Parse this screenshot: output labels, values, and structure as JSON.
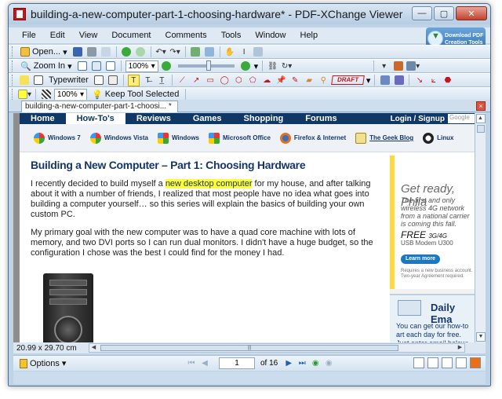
{
  "window": {
    "title": "building-a-new-computer-part-1-choosing-hardware* - PDF-XChange Viewer",
    "controls": {
      "minimize": "—",
      "maximize": "▢",
      "close": "✕"
    }
  },
  "menu": {
    "items": [
      "File",
      "Edit",
      "View",
      "Document",
      "Comments",
      "Tools",
      "Window",
      "Help"
    ],
    "download_badge": "Download PDF Creation Tools"
  },
  "toolbar": {
    "open_label": "Open...",
    "zoom_in_label": "Zoom In",
    "zoom_value": "100%",
    "typewriter_label": "Typewriter",
    "draft_stamp": "DRAFT",
    "props_zoom": "100%",
    "keep_tool_label": "Keep Tool Selected"
  },
  "tab": {
    "label": "building-a-new-computer-part-1-choosi... *",
    "close": "×"
  },
  "page_content": {
    "nav": {
      "items": [
        "Home",
        "How-To's",
        "Reviews",
        "Games",
        "Shopping",
        "Forums"
      ],
      "active_index": 1,
      "login": "Login / Signup",
      "search_placeholder": "Google"
    },
    "subnav": [
      "Windows 7",
      "Windows Vista",
      "Windows",
      "Microsoft Office",
      "Firefox & Internet",
      "The Geek Blog",
      "Linux"
    ],
    "article": {
      "title": "Building a New Computer – Part 1: Choosing Hardware",
      "p1_before": "I recently decided to build myself a ",
      "p1_highlight": "new desktop computer",
      "p1_after": " for my house, and after talking about it with a number of friends, I realized that most people have no idea what goes into building a computer yourself… so this series will explain the basics of building your own custom PC.",
      "p2": "My primary goal with the new computer was to have a quad core machine with lots of memory, and two DVI ports so I can run dual monitors. I didn't have a huge budget, so the configuration I chose was the best I could find for the money I had."
    },
    "ad": {
      "title": "Get ready, Phila",
      "body": "The first and only wireless 4G network from a national carrier is coming this fall.",
      "free_label": "FREE",
      "free_suffix": "3G/4G",
      "model": "USB Modem U300",
      "button": "Learn more",
      "fine_print": "Requires a new business account. Two-year Agreement required."
    },
    "email_box": {
      "title": "Daily Ema",
      "body": "You can get our how-to art each day for free. Just enter email below:"
    }
  },
  "status": {
    "page_size": "20.99 x 29.70 cm",
    "current_page": "1",
    "of_pages": "of 16",
    "options_label": "Options"
  },
  "colors": {
    "site_nav_bg": "#0f3867",
    "title_blue": "#15366b",
    "highlight": "#ffff33",
    "chrome": "#bfd3e6"
  }
}
